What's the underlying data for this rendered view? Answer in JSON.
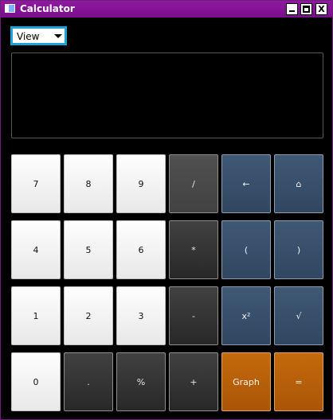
{
  "window": {
    "title": "Calculator",
    "controls": {
      "minimize_icon": "minimize-icon",
      "maximize_icon": "maximize-icon",
      "close_label": "X"
    }
  },
  "toolbar": {
    "view_label": "View"
  },
  "display": {
    "value": ""
  },
  "keypad": {
    "row1": [
      "7",
      "8",
      "9",
      "/",
      "←",
      "⌂"
    ],
    "row2": [
      "4",
      "5",
      "6",
      "*",
      "(",
      ")"
    ],
    "row3": [
      "1",
      "2",
      "3",
      "-",
      "x²",
      "√"
    ],
    "row4": [
      "0",
      ".",
      "%",
      "+",
      "Graph",
      "="
    ]
  },
  "colors": {
    "title_bar": "#8f1aa0",
    "focus_border": "#1ba2d8",
    "light_key": "#f2f2f2",
    "dark_key": "#2f2f2f",
    "blue_key": "#385069",
    "orange_key": "#b45f09"
  }
}
